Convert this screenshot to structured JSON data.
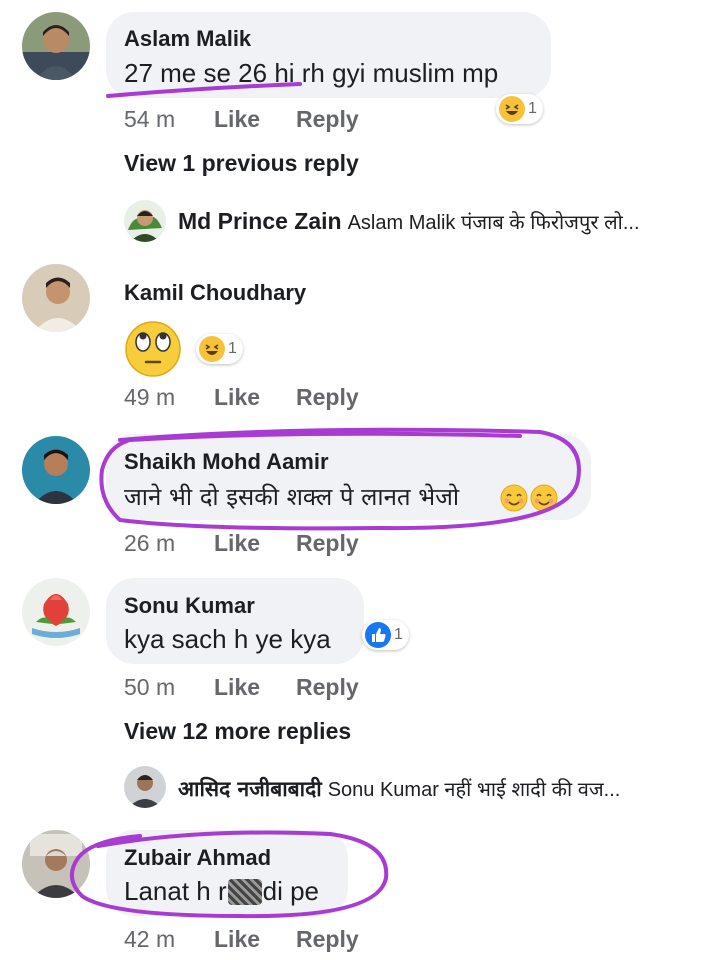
{
  "comments": [
    {
      "name": "Aslam Malik",
      "text": "27 me se 26 hi rh gyi muslim mp",
      "time": "54 m",
      "like": "Like",
      "reply": "Reply",
      "reaction_count": "1",
      "reaction": "haha"
    },
    {
      "name": "Kamil Choudhary",
      "text": "",
      "time": "49 m",
      "like": "Like",
      "reply": "Reply",
      "reaction_count": "1",
      "reaction": "haha"
    },
    {
      "name": "Shaikh Mohd Aamir",
      "text": "जाने भी दो इसकी शक्ल पे लानत भेजो",
      "time": "26 m",
      "like": "Like",
      "reply": "Reply"
    },
    {
      "name": "Sonu Kumar",
      "text": "kya sach h ye kya",
      "time": "50 m",
      "like": "Like",
      "reply": "Reply",
      "reaction_count": "1",
      "reaction": "like"
    },
    {
      "name": "Zubair Ahmad",
      "text": "Lanat h r",
      "text_after": "di pe",
      "time": "42 m",
      "like": "Like",
      "reply": "Reply"
    }
  ],
  "view_previous": "View 1 previous reply",
  "view_more": "View 12 more replies",
  "replies": [
    {
      "name": "Md Prince Zain",
      "text": "Aslam Malik पंजाब के फिरोजपुर लो..."
    },
    {
      "name": "आसिद नजीबाबादी",
      "text": "Sonu Kumar नहीं भाई शादी की वज..."
    }
  ],
  "colors": {
    "bubble": "#f0f2f5",
    "meta": "#65676b",
    "annotation": "#a83bd1",
    "like_blue": "#1877f2",
    "haha_yellow": "#f7c23b"
  }
}
